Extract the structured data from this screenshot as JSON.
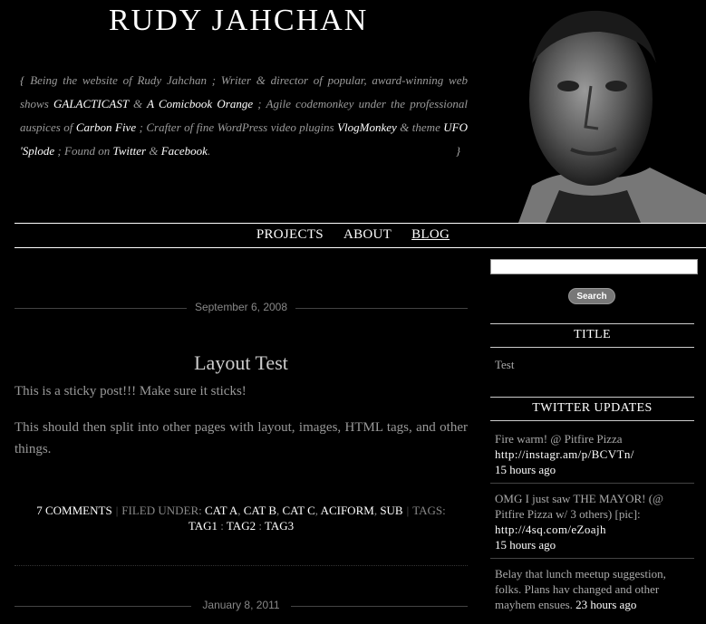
{
  "site": {
    "title": "RUDY JAHCHAN"
  },
  "tagline": {
    "open": "{",
    "close": "}",
    "t1": "Being the website of Rudy Jahchan ; Writer & director of popular, award-winning web shows ",
    "l1": "GALACTICAST",
    "t2": " & ",
    "l2": "A Comicbook Orange",
    "t3": " ; Agile codemonkey under the professional auspices of ",
    "l3": "Carbon Five",
    "t4": " ; Crafter of fine WordPress video plugins ",
    "l4": "VlogMonkey",
    "t5": " & theme ",
    "l5": "UFO 'Splode",
    "t6": " ; Found on ",
    "l6": "Twitter",
    "t7": " & ",
    "l7": "Facebook",
    "t8": "."
  },
  "nav": {
    "items": [
      {
        "label": "PROJECTS"
      },
      {
        "label": "ABOUT"
      },
      {
        "label": "BLOG"
      }
    ]
  },
  "post": {
    "date": "September 6, 2008",
    "title": "Layout Test",
    "p1": "This is a sticky post!!! Make sure it sticks!",
    "p2": "This should then split into other pages with layout, images, HTML tags, and other things.",
    "comments": "7 COMMENTS",
    "filed_label": "FILED UNDER:",
    "cats": [
      "CAT A",
      "CAT B",
      "CAT C",
      "ACIFORM",
      "SUB"
    ],
    "tags_label": "TAGS:",
    "tags": [
      "TAG1",
      "TAG2",
      "TAG3"
    ]
  },
  "next_post": {
    "date": "January 8, 2011"
  },
  "sidebar": {
    "search_button": "Search",
    "title_widget": {
      "heading": "TITLE",
      "text": "Test"
    },
    "twitter": {
      "heading": "TWITTER UPDATES",
      "tweets": [
        {
          "text": "Fire warm! @ Pitfire Pizza",
          "link": "http://instagr.am/p/BCVTn/",
          "ago": "15 hours ago"
        },
        {
          "text": "OMG I just saw THE MAYOR! (@ Pitfire Pizza w/ 3 others) [pic]:",
          "link": "http://4sq.com/eZoajh",
          "ago": "15 hours ago"
        },
        {
          "text": "Belay that lunch meetup suggestion, folks. Plans hav changed and other mayhem ensues.",
          "link": "",
          "ago": "23 hours ago"
        }
      ]
    }
  },
  "colors": {
    "background": "#000000",
    "link": "#ffffff",
    "text": "#aaaaaa"
  }
}
